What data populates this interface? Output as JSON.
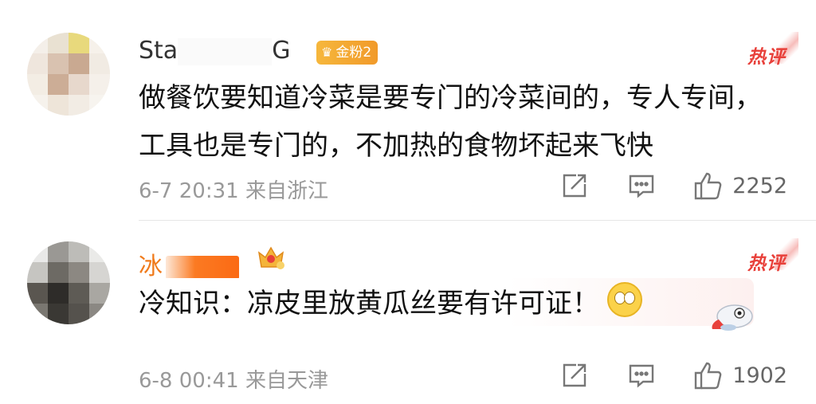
{
  "comments": [
    {
      "username_prefix": "Sta",
      "username_suffix": "G",
      "badge_label": "金粉2",
      "hot_label": "热评",
      "text": "做餐饮要知道冷菜是要专门的冷菜间的，专人专间，工具也是专门的，不加热的食物坏起来飞快",
      "timestamp": "6-7 20:31",
      "location": "来自浙江",
      "likes": "2252",
      "icons": [
        "share-icon",
        "comment-icon",
        "like-icon"
      ]
    },
    {
      "username_prefix": "冰",
      "hot_label": "热评",
      "text": "冷知识：凉皮里放黄瓜丝要有许可证！",
      "timestamp": "6-8 00:41",
      "location": "来自天津",
      "likes": "1902",
      "icons": [
        "vip-crown-icon",
        "emoji-icon",
        "share-icon",
        "comment-icon",
        "like-icon"
      ]
    }
  ],
  "colors": {
    "hot": "#e8403a",
    "username_vip": "#f07b1c",
    "badge": "#f3a830",
    "meta": "#999999"
  }
}
